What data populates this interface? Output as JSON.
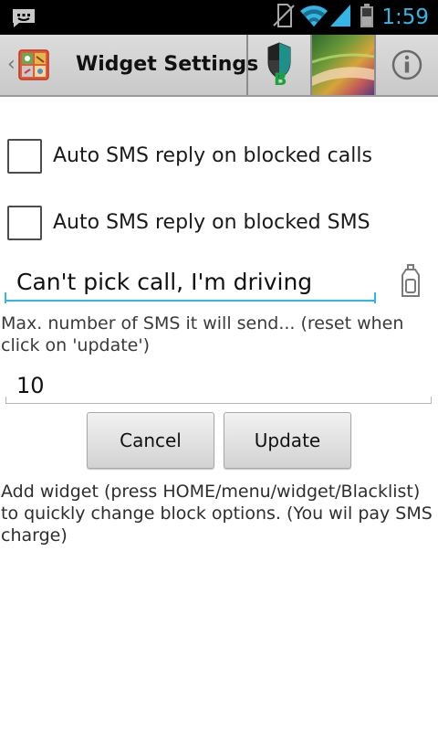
{
  "status_bar": {
    "time": "1:59",
    "icons": [
      "message-notification-icon",
      "no-sim-icon",
      "wifi-icon",
      "signal-icon",
      "battery-icon"
    ]
  },
  "action_bar": {
    "title": "Widget Settings",
    "shield_letter": "B",
    "icons": [
      "back-caret-icon",
      "app-icon",
      "shield-icon",
      "wallpaper-thumbnail",
      "info-icon"
    ]
  },
  "options": {
    "reply_calls": {
      "label": "Auto SMS reply on blocked calls",
      "checked": false
    },
    "reply_sms": {
      "label": "Auto SMS reply on blocked SMS",
      "checked": false
    }
  },
  "message_field": {
    "value": "Can't pick call, I'm driving",
    "icon": "paste-icon"
  },
  "max_sms": {
    "hint": "Max. number of SMS it will send... (reset when click on 'update')",
    "value": "10"
  },
  "buttons": {
    "cancel": "Cancel",
    "update": "Update"
  },
  "footer": "Add widget (press HOME/menu/widget/Blacklist) to quickly change block options. (You wil pay SMS charge)",
  "colors": {
    "accent": "#33b5e5",
    "status_bar": "#000000",
    "action_bar": "#d4d4d4",
    "shield_letter": "#1aa33a"
  }
}
